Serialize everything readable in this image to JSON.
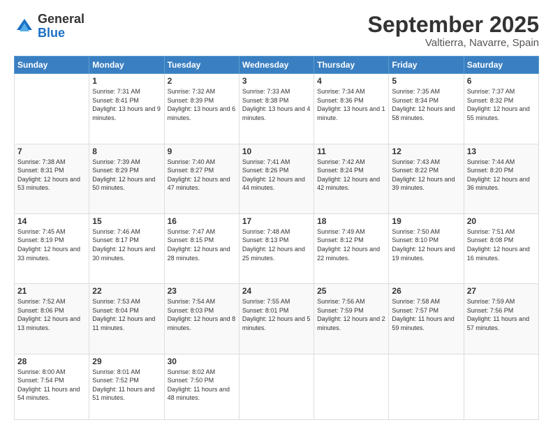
{
  "logo": {
    "general": "General",
    "blue": "Blue"
  },
  "header": {
    "month": "September 2025",
    "location": "Valtierra, Navarre, Spain"
  },
  "weekdays": [
    "Sunday",
    "Monday",
    "Tuesday",
    "Wednesday",
    "Thursday",
    "Friday",
    "Saturday"
  ],
  "weeks": [
    [
      {
        "day": "",
        "sunrise": "",
        "sunset": "",
        "daylight": ""
      },
      {
        "day": "1",
        "sunrise": "Sunrise: 7:31 AM",
        "sunset": "Sunset: 8:41 PM",
        "daylight": "Daylight: 13 hours and 9 minutes."
      },
      {
        "day": "2",
        "sunrise": "Sunrise: 7:32 AM",
        "sunset": "Sunset: 8:39 PM",
        "daylight": "Daylight: 13 hours and 6 minutes."
      },
      {
        "day": "3",
        "sunrise": "Sunrise: 7:33 AM",
        "sunset": "Sunset: 8:38 PM",
        "daylight": "Daylight: 13 hours and 4 minutes."
      },
      {
        "day": "4",
        "sunrise": "Sunrise: 7:34 AM",
        "sunset": "Sunset: 8:36 PM",
        "daylight": "Daylight: 13 hours and 1 minute."
      },
      {
        "day": "5",
        "sunrise": "Sunrise: 7:35 AM",
        "sunset": "Sunset: 8:34 PM",
        "daylight": "Daylight: 12 hours and 58 minutes."
      },
      {
        "day": "6",
        "sunrise": "Sunrise: 7:37 AM",
        "sunset": "Sunset: 8:32 PM",
        "daylight": "Daylight: 12 hours and 55 minutes."
      }
    ],
    [
      {
        "day": "7",
        "sunrise": "Sunrise: 7:38 AM",
        "sunset": "Sunset: 8:31 PM",
        "daylight": "Daylight: 12 hours and 53 minutes."
      },
      {
        "day": "8",
        "sunrise": "Sunrise: 7:39 AM",
        "sunset": "Sunset: 8:29 PM",
        "daylight": "Daylight: 12 hours and 50 minutes."
      },
      {
        "day": "9",
        "sunrise": "Sunrise: 7:40 AM",
        "sunset": "Sunset: 8:27 PM",
        "daylight": "Daylight: 12 hours and 47 minutes."
      },
      {
        "day": "10",
        "sunrise": "Sunrise: 7:41 AM",
        "sunset": "Sunset: 8:26 PM",
        "daylight": "Daylight: 12 hours and 44 minutes."
      },
      {
        "day": "11",
        "sunrise": "Sunrise: 7:42 AM",
        "sunset": "Sunset: 8:24 PM",
        "daylight": "Daylight: 12 hours and 42 minutes."
      },
      {
        "day": "12",
        "sunrise": "Sunrise: 7:43 AM",
        "sunset": "Sunset: 8:22 PM",
        "daylight": "Daylight: 12 hours and 39 minutes."
      },
      {
        "day": "13",
        "sunrise": "Sunrise: 7:44 AM",
        "sunset": "Sunset: 8:20 PM",
        "daylight": "Daylight: 12 hours and 36 minutes."
      }
    ],
    [
      {
        "day": "14",
        "sunrise": "Sunrise: 7:45 AM",
        "sunset": "Sunset: 8:19 PM",
        "daylight": "Daylight: 12 hours and 33 minutes."
      },
      {
        "day": "15",
        "sunrise": "Sunrise: 7:46 AM",
        "sunset": "Sunset: 8:17 PM",
        "daylight": "Daylight: 12 hours and 30 minutes."
      },
      {
        "day": "16",
        "sunrise": "Sunrise: 7:47 AM",
        "sunset": "Sunset: 8:15 PM",
        "daylight": "Daylight: 12 hours and 28 minutes."
      },
      {
        "day": "17",
        "sunrise": "Sunrise: 7:48 AM",
        "sunset": "Sunset: 8:13 PM",
        "daylight": "Daylight: 12 hours and 25 minutes."
      },
      {
        "day": "18",
        "sunrise": "Sunrise: 7:49 AM",
        "sunset": "Sunset: 8:12 PM",
        "daylight": "Daylight: 12 hours and 22 minutes."
      },
      {
        "day": "19",
        "sunrise": "Sunrise: 7:50 AM",
        "sunset": "Sunset: 8:10 PM",
        "daylight": "Daylight: 12 hours and 19 minutes."
      },
      {
        "day": "20",
        "sunrise": "Sunrise: 7:51 AM",
        "sunset": "Sunset: 8:08 PM",
        "daylight": "Daylight: 12 hours and 16 minutes."
      }
    ],
    [
      {
        "day": "21",
        "sunrise": "Sunrise: 7:52 AM",
        "sunset": "Sunset: 8:06 PM",
        "daylight": "Daylight: 12 hours and 13 minutes."
      },
      {
        "day": "22",
        "sunrise": "Sunrise: 7:53 AM",
        "sunset": "Sunset: 8:04 PM",
        "daylight": "Daylight: 12 hours and 11 minutes."
      },
      {
        "day": "23",
        "sunrise": "Sunrise: 7:54 AM",
        "sunset": "Sunset: 8:03 PM",
        "daylight": "Daylight: 12 hours and 8 minutes."
      },
      {
        "day": "24",
        "sunrise": "Sunrise: 7:55 AM",
        "sunset": "Sunset: 8:01 PM",
        "daylight": "Daylight: 12 hours and 5 minutes."
      },
      {
        "day": "25",
        "sunrise": "Sunrise: 7:56 AM",
        "sunset": "Sunset: 7:59 PM",
        "daylight": "Daylight: 12 hours and 2 minutes."
      },
      {
        "day": "26",
        "sunrise": "Sunrise: 7:58 AM",
        "sunset": "Sunset: 7:57 PM",
        "daylight": "Daylight: 11 hours and 59 minutes."
      },
      {
        "day": "27",
        "sunrise": "Sunrise: 7:59 AM",
        "sunset": "Sunset: 7:56 PM",
        "daylight": "Daylight: 11 hours and 57 minutes."
      }
    ],
    [
      {
        "day": "28",
        "sunrise": "Sunrise: 8:00 AM",
        "sunset": "Sunset: 7:54 PM",
        "daylight": "Daylight: 11 hours and 54 minutes."
      },
      {
        "day": "29",
        "sunrise": "Sunrise: 8:01 AM",
        "sunset": "Sunset: 7:52 PM",
        "daylight": "Daylight: 11 hours and 51 minutes."
      },
      {
        "day": "30",
        "sunrise": "Sunrise: 8:02 AM",
        "sunset": "Sunset: 7:50 PM",
        "daylight": "Daylight: 11 hours and 48 minutes."
      },
      {
        "day": "",
        "sunrise": "",
        "sunset": "",
        "daylight": ""
      },
      {
        "day": "",
        "sunrise": "",
        "sunset": "",
        "daylight": ""
      },
      {
        "day": "",
        "sunrise": "",
        "sunset": "",
        "daylight": ""
      },
      {
        "day": "",
        "sunrise": "",
        "sunset": "",
        "daylight": ""
      }
    ]
  ]
}
